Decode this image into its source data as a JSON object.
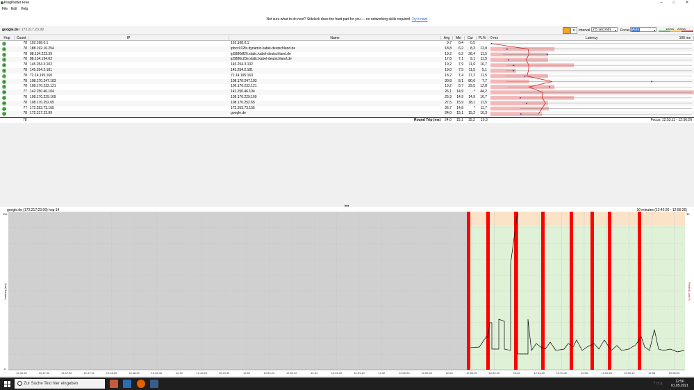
{
  "window": {
    "title": "PingPlotter Free"
  },
  "menu": [
    "File",
    "Edit",
    "Help"
  ],
  "banner": {
    "text": "Not sure what to do next? Sidekick does the hard part for you — no networking skills required.",
    "link": "Try it now!"
  },
  "toolbar": {
    "target_name": "google.de",
    "target_ip": "/ 172.217.23.99",
    "interval_label": "Interval",
    "interval_value": "2.5 seconds",
    "focus_label": "Focus",
    "focus_value": "Auto",
    "legend_100": "100ms",
    "legend_200": "200ms"
  },
  "table": {
    "headers": [
      "Hop",
      "Count",
      "IP",
      "Name",
      "Avg",
      "Min",
      "Cur",
      "PL%",
      "0 ms",
      "Latency",
      "100 ms"
    ],
    "rows": [
      {
        "hop": "1",
        "count": "78",
        "ip": "192.168.0.1",
        "name": "192.168.0.1",
        "avg": "0,7",
        "min": "0,4",
        "cur": "0,5",
        "pl": ""
      },
      {
        "hop": "2",
        "count": "78",
        "ip": "188.192.16.254",
        "name": "ipbcc012fe.dynamic.kabel-deutschland.de",
        "avg": "18,8",
        "min": "6,2",
        "cur": "8,3",
        "pl": "12,8"
      },
      {
        "hop": "3",
        "count": "78",
        "ip": "88.134.223.39",
        "name": "ip5886df26.static.kabel-deutschland.de",
        "avg": "19,2",
        "min": "6,2",
        "cur": "28,4",
        "pl": "11,5"
      },
      {
        "hop": "4",
        "count": "78",
        "ip": "88.134.194.62",
        "name": "ip5886c23e.static.kabel-deutschland.de",
        "avg": "17,8",
        "min": "7,1",
        "cur": "9,1",
        "pl": "11,5"
      },
      {
        "hop": "5",
        "count": "78",
        "ip": "145.254.3.102",
        "name": "145.254.3.102",
        "avg": "19,2",
        "min": "7,9",
        "cur": "11,6",
        "pl": "16,7"
      },
      {
        "hop": "6",
        "count": "78",
        "ip": "145.254.2.181",
        "name": "145.254.2.181",
        "avg": "19,0",
        "min": "7,5",
        "cur": "11,5",
        "pl": "5,1"
      },
      {
        "hop": "7",
        "count": "78",
        "ip": "72.14.195.160",
        "name": "72.14.195.160",
        "avg": "18,2",
        "min": "7,4",
        "cur": "17,2",
        "pl": "11,5"
      },
      {
        "hop": "8",
        "count": "78",
        "ip": "108.170.247.103",
        "name": "108.170.247.103",
        "avg": "30,8",
        "min": "8,1",
        "cur": "80,6",
        "pl": "7,7"
      },
      {
        "hop": "9",
        "count": "78",
        "ip": "108.170.232.121",
        "name": "108.170.232.121",
        "avg": "19,2",
        "min": "8,7",
        "cur": "29,5",
        "pl": "12,8"
      },
      {
        "hop": "10",
        "count": "77",
        "ip": "142.250.46.104",
        "name": "142.250.46.104",
        "avg": "26,1",
        "min": "14,9",
        "cur": "*",
        "pl": "44,2"
      },
      {
        "hop": "11",
        "count": "78",
        "ip": "108.170.229.169",
        "name": "108.170.229.169",
        "avg": "25,9",
        "min": "14,9",
        "cur": "14,9",
        "pl": "16,7"
      },
      {
        "hop": "12",
        "count": "78",
        "ip": "108.170.252.65",
        "name": "108.170.252.65",
        "avg": "27,5",
        "min": "15,9",
        "cur": "18,1",
        "pl": "11,5"
      },
      {
        "hop": "13",
        "count": "77",
        "ip": "172.253.73.155",
        "name": "172.253.73.155",
        "avg": "25,7",
        "min": "14,8",
        "cur": "*",
        "pl": "11,7"
      },
      {
        "hop": "14",
        "count": "78",
        "ip": "172.217.23.99",
        "name": "google.de",
        "avg": "24,0",
        "min": "15,1",
        "cur": "15,2",
        "pl": "10,3"
      }
    ],
    "summary": {
      "count": "78",
      "label": "Round Trip (ms)",
      "avg": "24,0",
      "min": "15,1",
      "cur": "15,2",
      "pl": "10,3",
      "focus": "Focus: 12:53:11 - 12:56:26"
    }
  },
  "graph": {
    "title": "google.de (172.217.23.99) hop 14",
    "range": "10 minutes (12:46:26 - 12:56:26)",
    "y_label": "Latency (ms)",
    "y2_label": "Packet Loss %",
    "y_max_label": "110",
    "y2_max_label": "30",
    "zero_label": "0",
    "time_labels": [
      "12:46:40",
      "12:47:00",
      "12:47:20",
      "12:47:40",
      "12:48:00",
      "12:48:20",
      "12:48:40",
      "12:49",
      "12:49:20",
      "12:49:40",
      "12:50",
      "12:50:20",
      "12:50:40",
      "12:51",
      "12:51:20",
      "12:51:40",
      "12:52",
      "12:52:20",
      "12:52:40",
      "12:53",
      "12:53:20",
      "12:53:40",
      "12:54",
      "12:54:20",
      "12:54:40",
      "12:55",
      "12:55:20",
      "12:55:40",
      "12:56",
      "12:56:20"
    ]
  },
  "taskbar": {
    "search_placeholder": "Zur Suche Text hier eingeben",
    "time": "12:56",
    "date": "01.05.2021"
  },
  "colors": {
    "good": "#5cb85c",
    "loss": "#ff0000",
    "latency_bar": "#f4b8b8",
    "graph_ok": "#dff2d8",
    "graph_warn": "#fbe3c8",
    "graph_empty": "#d0d0d0"
  }
}
